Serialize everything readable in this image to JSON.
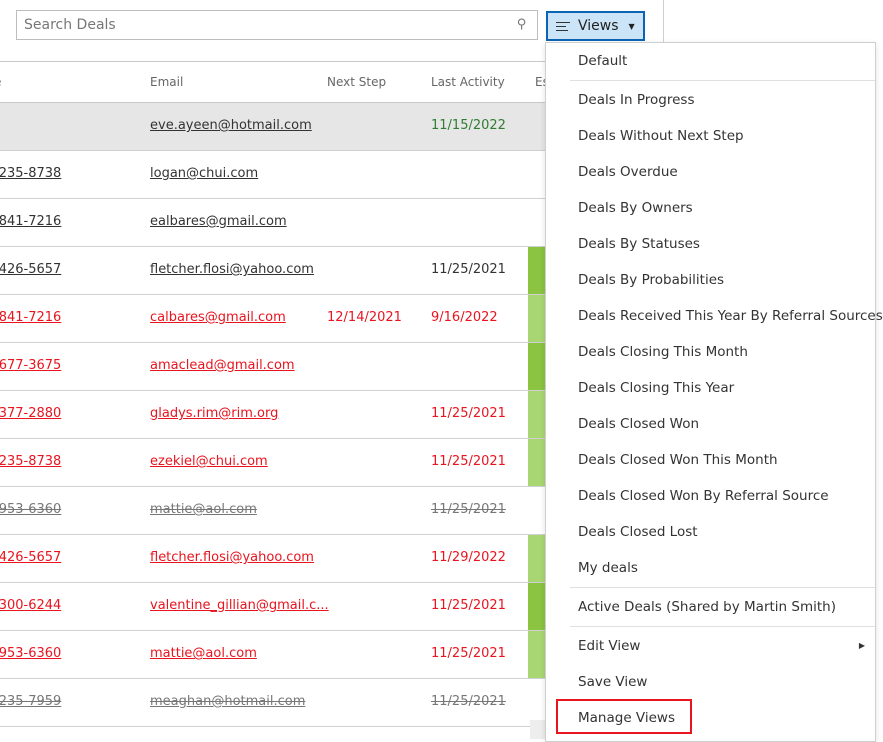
{
  "search": {
    "placeholder": "Search Deals",
    "icon": "search-icon"
  },
  "views_button": {
    "label": "Views",
    "icon": "lines-icon"
  },
  "table": {
    "headers": [
      "e",
      "Email",
      "Next Step",
      "Last Activity",
      "Es"
    ],
    "rows": [
      {
        "style": "selected",
        "phone": "",
        "email": "eve.ayeen@hotmail.com",
        "next_step": "",
        "last_activity": "11/15/2022",
        "bar": ""
      },
      {
        "style": "normal",
        "phone": "-235-8738",
        "email": "logan@chui.com",
        "next_step": "",
        "last_activity": "",
        "bar": ""
      },
      {
        "style": "normal",
        "phone": "-841-7216",
        "email": "ealbares@gmail.com",
        "next_step": "",
        "last_activity": "",
        "bar": ""
      },
      {
        "style": "normal",
        "phone": "-426-5657",
        "email": "fletcher.flosi@yahoo.com",
        "next_step": "",
        "last_activity": "11/25/2021",
        "bar": "#8bc441"
      },
      {
        "style": "red",
        "phone": "-841-7216",
        "email": "calbares@gmail.com",
        "next_step": "12/14/2021",
        "last_activity": "9/16/2022",
        "bar": "#a8d672"
      },
      {
        "style": "red",
        "phone": "-677-3675",
        "email": "amaclead@gmail.com",
        "next_step": "",
        "last_activity": "",
        "bar": "#8bc441"
      },
      {
        "style": "red",
        "phone": "-377-2880",
        "email": "gladys.rim@rim.org",
        "next_step": "",
        "last_activity": "11/25/2021",
        "bar": "#a8d672"
      },
      {
        "style": "red",
        "phone": "-235-8738",
        "email": "ezekiel@chui.com",
        "next_step": "",
        "last_activity": "11/25/2021",
        "bar": "#a8d672"
      },
      {
        "style": "strike",
        "phone": "-953-6360",
        "email": "mattie@aol.com",
        "next_step": "",
        "last_activity": "11/25/2021",
        "bar": ""
      },
      {
        "style": "red",
        "phone": "-426-5657",
        "email": "fletcher.flosi@yahoo.com",
        "next_step": "",
        "last_activity": "11/29/2022",
        "bar": "#a8d672"
      },
      {
        "style": "red",
        "phone": "-300-6244",
        "email": "valentine_gillian@gmail.c...",
        "next_step": "",
        "last_activity": "11/25/2021",
        "bar": "#8bc441"
      },
      {
        "style": "red",
        "phone": "-953-6360",
        "email": "mattie@aol.com",
        "next_step": "",
        "last_activity": "11/25/2021",
        "bar": "#a8d672"
      },
      {
        "style": "strike",
        "phone": "-235-7959",
        "email": "meaghan@hotmail.com",
        "next_step": "",
        "last_activity": "11/25/2021",
        "bar": ""
      }
    ]
  },
  "views_menu": {
    "items": [
      {
        "label": "Default"
      },
      {
        "separator": true
      },
      {
        "label": "Deals In Progress"
      },
      {
        "label": "Deals Without Next Step"
      },
      {
        "label": "Deals Overdue"
      },
      {
        "label": "Deals By Owners"
      },
      {
        "label": "Deals By Statuses"
      },
      {
        "label": "Deals By Probabilities"
      },
      {
        "label": "Deals Received This Year By Referral Sources"
      },
      {
        "label": "Deals Closing This Month"
      },
      {
        "label": "Deals Closing This Year"
      },
      {
        "label": "Deals Closed Won"
      },
      {
        "label": "Deals Closed Won This Month"
      },
      {
        "label": "Deals Closed Won By Referral Source"
      },
      {
        "label": "Deals Closed Lost"
      },
      {
        "label": "My deals"
      },
      {
        "separator": true
      },
      {
        "label": "Active Deals (Shared by Martin Smith)"
      },
      {
        "separator": true
      },
      {
        "label": "Edit View",
        "submenu": true
      },
      {
        "label": "Save View"
      },
      {
        "label": "Manage Views",
        "highlighted": true
      }
    ]
  },
  "colors": {
    "accent": "#0a64b4",
    "overdue": "#e8141e",
    "recent_activity": "#2e7d32",
    "highlight_box": "#e8141e"
  }
}
